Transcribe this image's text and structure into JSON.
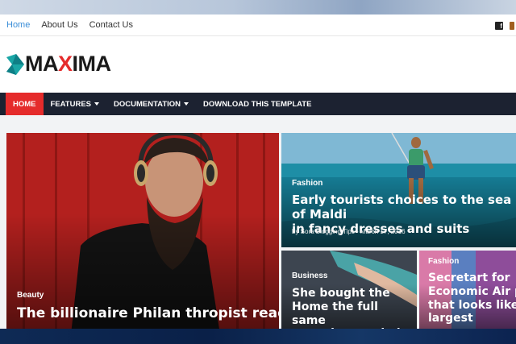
{
  "topbar": {
    "links": [
      {
        "label": "Home",
        "active": true
      },
      {
        "label": "About Us",
        "active": false
      },
      {
        "label": "Contact Us",
        "active": false
      }
    ],
    "social_icons": [
      "facebook-icon",
      "twitter-icon"
    ]
  },
  "header": {
    "logo_prefix": "MA",
    "logo_x": "X",
    "logo_suffix": "IMA",
    "logo_colors": {
      "mark": "#1aa6a6",
      "text": "#1a1a1a",
      "x": "#e52b2b"
    }
  },
  "nav": {
    "items": [
      {
        "label": "HOME",
        "dropdown": false,
        "active": true
      },
      {
        "label": "FEATURES",
        "dropdown": true,
        "active": false
      },
      {
        "label": "DOCUMENTATION",
        "dropdown": true,
        "active": false
      },
      {
        "label": "DOWNLOAD THIS TEMPLATE",
        "dropdown": false,
        "active": false
      }
    ],
    "colors": {
      "bar": "#1c2231",
      "active": "#e52b2b"
    }
  },
  "posts": {
    "main": {
      "label": "Beauty",
      "title": "The billionaire Philan thropist read to"
    },
    "fashion": {
      "label": "Fashion",
      "title": "Early tourists choices to the sea of Maldi in fancy dresses and suits",
      "meta": "by Sora Blogging Tips - March 17, 2016"
    },
    "business": {
      "label": "Business",
      "title": "She bought the Home the full same year she married"
    },
    "fashion2": {
      "label": "Fashion",
      "title": "Secretart for Economic Air pla that looks like largest"
    }
  }
}
